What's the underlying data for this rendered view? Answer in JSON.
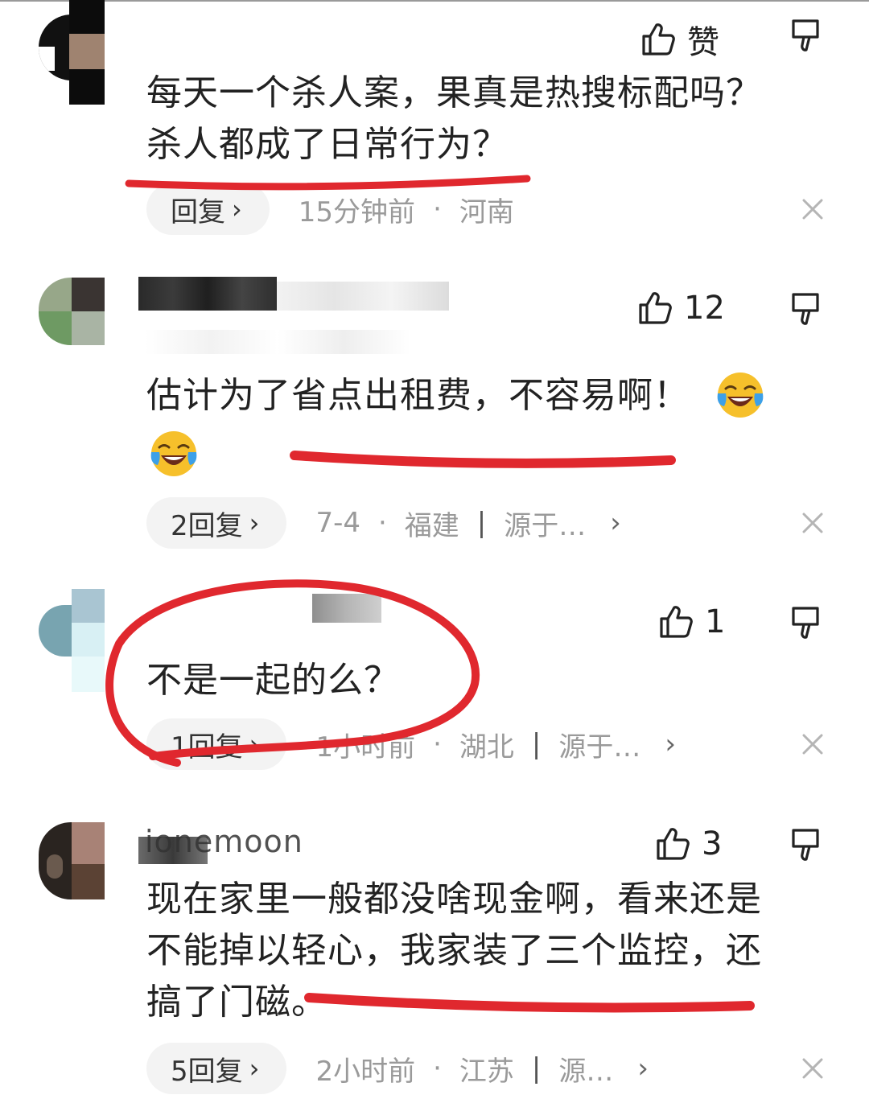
{
  "comments": [
    {
      "like_label": "赞",
      "text_line1": "每天一个杀人案，果真是热搜标配吗？",
      "text_line2": "杀人都成了日常行为？",
      "reply_label": "回复",
      "time": "15分钟前",
      "location": "河南"
    },
    {
      "likes": "12",
      "text": "估计为了省点出租费，不容易啊！",
      "emoji": "laughing-crying-emoji",
      "reply_label": "2回复",
      "time": "7-4",
      "location": "福建",
      "source": "源于…"
    },
    {
      "likes": "1",
      "text": "不是一起的么？",
      "reply_label": "1回复",
      "time": "1小时前",
      "location": "湖北",
      "source": "源于…"
    },
    {
      "username": "ionemoon",
      "likes": "3",
      "text_line1": "现在家里一般都没啥现金啊，看来还是",
      "text_line2": "不能掉以轻心，我家装了三个监控，还",
      "text_line3": "搞了门磁。",
      "reply_label": "5回复",
      "time": "2小时前",
      "location": "江苏",
      "source": "源…"
    }
  ],
  "colors": {
    "annotation": "#e0282e",
    "meta_text": "#9a9a9a",
    "pill_bg": "#f3f3f3"
  }
}
